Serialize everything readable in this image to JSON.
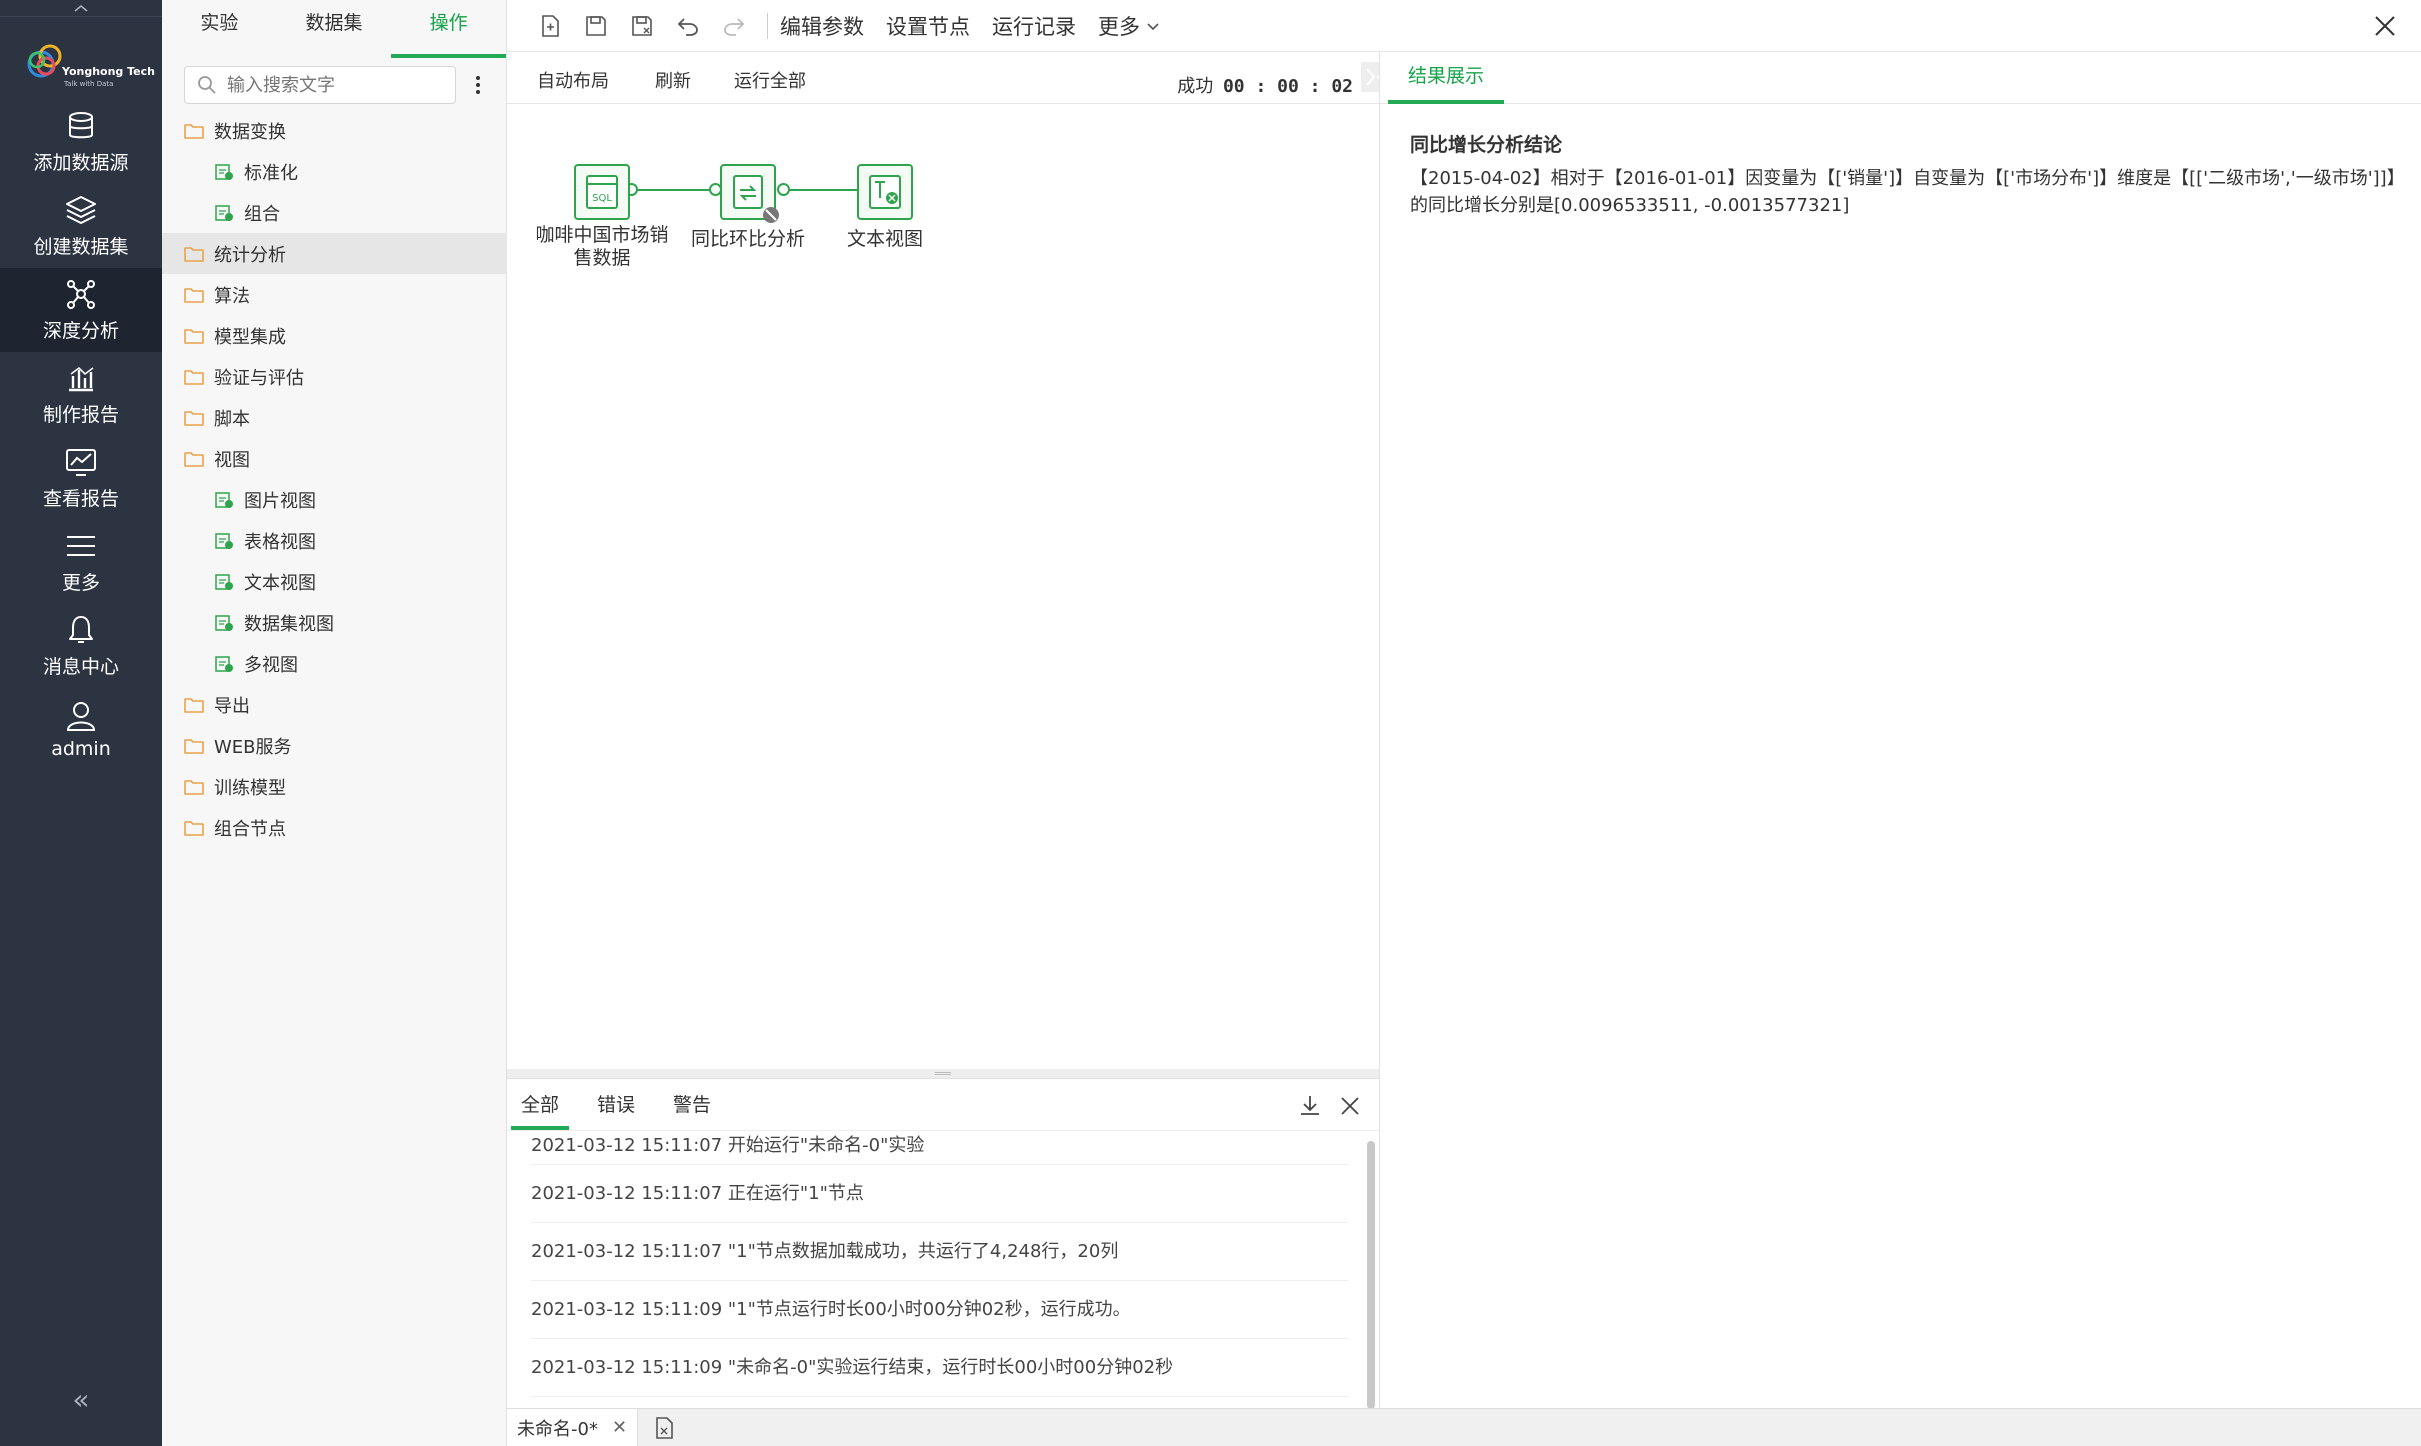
{
  "left_nav": {
    "logo": {
      "brand": "Yonghong Tech",
      "slogan": "Talk with Data"
    },
    "items": [
      {
        "label": "添加数据源",
        "icon": "database-icon"
      },
      {
        "label": "创建数据集",
        "icon": "layers-icon"
      },
      {
        "label": "深度分析",
        "icon": "network-icon",
        "active": true
      },
      {
        "label": "制作报告",
        "icon": "bar-chart-icon"
      },
      {
        "label": "查看报告",
        "icon": "line-chart-icon"
      },
      {
        "label": "更多",
        "icon": "menu-icon"
      },
      {
        "label": "消息中心",
        "icon": "bell-icon"
      },
      {
        "label": "admin",
        "icon": "user-icon"
      }
    ],
    "collapse_symbol": "«"
  },
  "panel_tabs": [
    {
      "label": "实验"
    },
    {
      "label": "数据集"
    },
    {
      "label": "操作",
      "active": true
    }
  ],
  "search": {
    "placeholder": "输入搜索文字"
  },
  "tree": [
    {
      "label": "数据变换",
      "type": "folder"
    },
    {
      "label": "标准化",
      "type": "leaf",
      "icon": "standardize-icon"
    },
    {
      "label": "组合",
      "type": "leaf",
      "icon": "combine-icon"
    },
    {
      "label": "统计分析",
      "type": "folder",
      "selected": true
    },
    {
      "label": "算法",
      "type": "folder"
    },
    {
      "label": "模型集成",
      "type": "folder"
    },
    {
      "label": "验证与评估",
      "type": "folder"
    },
    {
      "label": "脚本",
      "type": "folder"
    },
    {
      "label": "视图",
      "type": "folder"
    },
    {
      "label": "图片视图",
      "type": "leaf",
      "icon": "image-view-icon"
    },
    {
      "label": "表格视图",
      "type": "leaf",
      "icon": "table-view-icon"
    },
    {
      "label": "文本视图",
      "type": "leaf",
      "icon": "text-view-icon"
    },
    {
      "label": "数据集视图",
      "type": "leaf",
      "icon": "dataset-view-icon"
    },
    {
      "label": "多视图",
      "type": "leaf",
      "icon": "multi-view-icon"
    },
    {
      "label": "导出",
      "type": "folder"
    },
    {
      "label": "WEB服务",
      "type": "folder"
    },
    {
      "label": "训练模型",
      "type": "folder"
    },
    {
      "label": "组合节点",
      "type": "folder"
    }
  ],
  "toolbar": {
    "links": [
      "编辑参数",
      "设置节点",
      "运行记录",
      "更多"
    ]
  },
  "canvas_bar": {
    "auto_layout": "自动布局",
    "refresh": "刷新",
    "run_all": "运行全部",
    "status_label": "成功",
    "status_time": "00 : 00 : 02"
  },
  "nodes": [
    {
      "label": "咖啡中国市场销售数据",
      "icon": "sql-node-icon"
    },
    {
      "label": "同比环比分析",
      "icon": "transform-node-icon"
    },
    {
      "label": "文本视图",
      "icon": "text-view-node-icon"
    }
  ],
  "log": {
    "tabs": [
      "全部",
      "错误",
      "警告"
    ],
    "lines": [
      "2021-03-12 15:11:07 开始运行\"未命名-0\"实验",
      "2021-03-12 15:11:07 正在运行\"1\"节点",
      "2021-03-12 15:11:07 \"1\"节点数据加载成功，共运行了4,248行，20列",
      "2021-03-12 15:11:09 \"1\"节点运行时长00小时00分钟02秒，运行成功。",
      "2021-03-12 15:11:09 \"未命名-0\"实验运行结束，运行时长00小时00分钟02秒"
    ]
  },
  "doc_tab": {
    "label": "未命名-0*"
  },
  "result": {
    "tab": "结果展示",
    "title": "同比增长分析结论",
    "text": "【2015-04-02】相对于【2016-01-01】因变量为【['销量']】自变量为【['市场分布']】维度是【[['二级市场','一级市场']]】的同比增长分别是[0.0096533511, -0.0013577321]"
  },
  "colors": {
    "accent": "#22aa55",
    "nav_bg": "#2c3442",
    "nav_active": "#1e2530",
    "folder": "#e8a24a"
  }
}
